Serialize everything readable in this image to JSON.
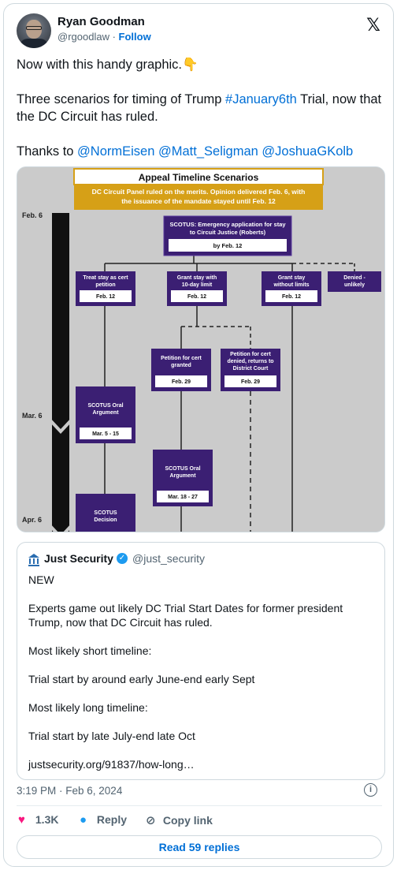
{
  "author": {
    "name": "Ryan Goodman",
    "handle": "@rgoodlaw",
    "separator": "·",
    "follow_label": "Follow"
  },
  "tweet": {
    "line1": "Now with this handy graphic.",
    "line1_emoji": "👇",
    "line2_a": "Three scenarios for timing of Trump ",
    "line2_hashtag": "#January6th",
    "line2_b": " Trial, now that the DC Circuit has ruled.",
    "line3_a": "Thanks to ",
    "mention1": "@NormEisen",
    "mention2": "@Matt_Seligman",
    "mention3": "@JoshuaGKolb"
  },
  "graphic": {
    "title": "Appeal Timeline Scenarios",
    "subtitle_1": "DC Circuit Panel ruled on the merits. Opinion delivered Feb. 6, with",
    "subtitle_2": "the issuance of the mandate stayed until Feb. 12",
    "dates": [
      "Feb. 6",
      "Mar. 6",
      "Apr. 6"
    ],
    "scotus_app_1": "SCOTUS: Emergency application for stay",
    "scotus_app_2": "to Circuit Justice (Roberts)",
    "scotus_app_date": "by Feb. 12",
    "treat_1": "Treat stay as cert",
    "treat_2": "petition",
    "treat_date": "Feb. 12",
    "grant10_1": "Grant stay with",
    "grant10_2": "10-day limit",
    "grant10_date": "Feb. 12",
    "grantnl_1": "Grant stay",
    "grantnl_2": "without limits",
    "grantnl_date": "Feb. 12",
    "denied_1": "Denied -",
    "denied_2": "unlikely",
    "petgranted_1": "Petition for cert",
    "petgranted_2": "granted",
    "petgranted_date": "Feb. 29",
    "petdenied_1": "Petition for cert",
    "petdenied_2": "denied, returns to",
    "petdenied_3": "District Court",
    "petdenied_date": "Feb. 29",
    "oral1_1": "SCOTUS Oral",
    "oral1_2": "Argument",
    "oral1_date": "Mar. 5 - 15",
    "oral2_1": "SCOTUS Oral",
    "oral2_2": "Argument",
    "oral2_date": "Mar. 18 - 27",
    "decision_1": "SCOTUS",
    "decision_2": "Decision"
  },
  "quote": {
    "name": "Just Security",
    "handle": "@just_security",
    "p1": "NEW",
    "p2": "Experts game out likely DC Trial Start Dates for former president Trump, now that DC Circuit has ruled.",
    "p3": "Most likely short timeline:",
    "p4": "Trial start by around early June-end early Sept",
    "p5": "Most likely long timeline:",
    "p6": "Trial start by late July-end late Oct",
    "p7": "justsecurity.org/91837/how-long…"
  },
  "meta": {
    "timestamp": "3:19 PM · Feb 6, 2024"
  },
  "actions": {
    "likes": "1.3K",
    "reply_label": "Reply",
    "copy_label": "Copy link",
    "read_replies": "Read 59 replies"
  },
  "colors": {
    "link": "#006fd6",
    "purple": "#3b1f73",
    "gold": "#d6a017",
    "like": "#f91880"
  }
}
